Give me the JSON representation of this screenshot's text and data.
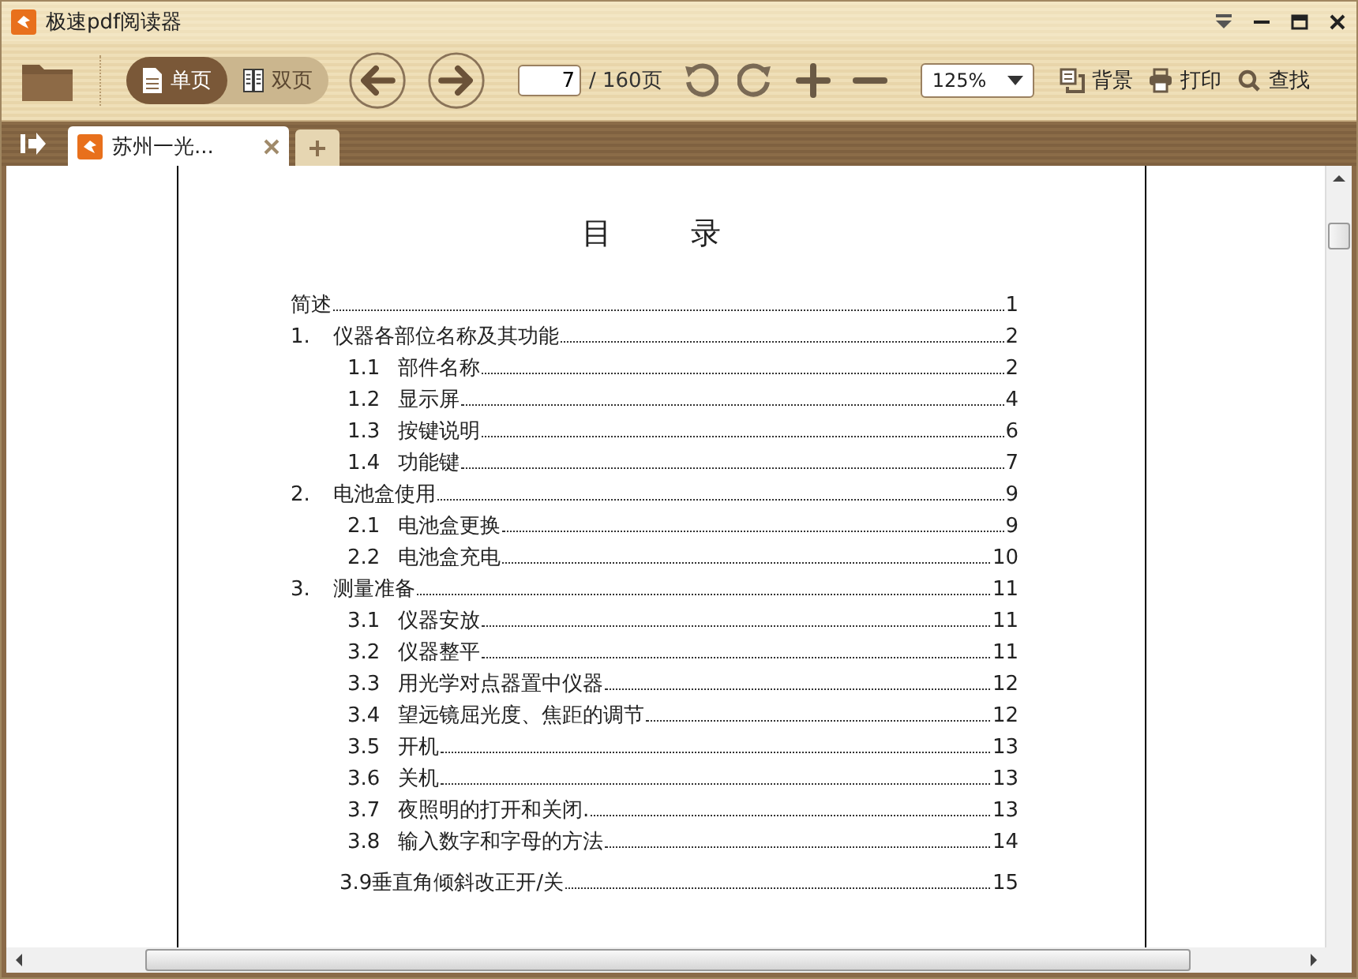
{
  "window": {
    "title": "极速pdf阅读器"
  },
  "toolbar": {
    "view_modes": [
      {
        "label": "单页",
        "selected": true
      },
      {
        "label": "双页",
        "selected": false
      }
    ],
    "page_input": {
      "value": "7"
    },
    "page_total": "/ 160页",
    "zoom": {
      "value": "125%"
    },
    "actions": [
      {
        "kind": "background",
        "label": "背景"
      },
      {
        "kind": "print",
        "label": "打印"
      },
      {
        "kind": "find",
        "label": "查找"
      }
    ]
  },
  "tabs": [
    {
      "label": "苏州一光...",
      "selected": true
    }
  ],
  "document": {
    "heading": "目　　录",
    "toc": [
      {
        "title": "简述",
        "page": "1"
      },
      {
        "number": "1.",
        "title": "仪器各部位名称及其功能",
        "page": "2",
        "children": [
          {
            "number": "1.1",
            "title": "部件名称",
            "page": "2"
          },
          {
            "number": "1.2",
            "title": "显示屏",
            "page": "4"
          },
          {
            "number": "1.3",
            "title": "按键说明",
            "page": "6"
          },
          {
            "number": "1.4",
            "title": "功能键",
            "page": "7"
          }
        ]
      },
      {
        "number": "2.",
        "title": "电池盒使用",
        "page": "9",
        "children": [
          {
            "number": "2.1",
            "title": "电池盒更换",
            "page": "9"
          },
          {
            "number": "2.2",
            "title": "电池盒充电",
            "page": "10"
          }
        ]
      },
      {
        "number": "3.",
        "title": "测量准备",
        "page": "11",
        "children": [
          {
            "number": "3.1",
            "title": "仪器安放",
            "page": "11"
          },
          {
            "number": "3.2",
            "title": "仪器整平",
            "page": "11"
          },
          {
            "number": "3.3",
            "title": "用光学对点器置中仪器",
            "page": "12"
          },
          {
            "number": "3.4",
            "title": "望远镜屈光度、焦距的调节",
            "page": "12"
          },
          {
            "number": "3.5",
            "title": "开机",
            "page": "13"
          },
          {
            "number": "3.6",
            "title": "关机",
            "page": "13"
          },
          {
            "number": "3.7",
            "title": "夜照明的打开和关闭.",
            "page": "13"
          },
          {
            "number": "3.8",
            "title": "输入数字和字母的方法",
            "page": "14"
          },
          {
            "title": "3.9垂直角倾斜改正开/关",
            "page": "15"
          }
        ]
      }
    ]
  }
}
